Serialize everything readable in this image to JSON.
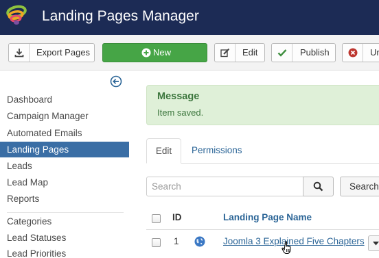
{
  "header": {
    "title": "Landing Pages Manager"
  },
  "toolbar": {
    "export_label": "Export Pages",
    "new_label": "New",
    "edit_label": "Edit",
    "publish_label": "Publish",
    "unpublish_label": "Ur"
  },
  "sidebar": {
    "items": [
      {
        "label": "Dashboard"
      },
      {
        "label": "Campaign Manager"
      },
      {
        "label": "Automated Emails"
      },
      {
        "label": "Landing Pages",
        "active": true
      },
      {
        "label": "Leads"
      },
      {
        "label": "Lead Map"
      },
      {
        "label": "Reports"
      }
    ],
    "items2": [
      {
        "label": "Categories"
      },
      {
        "label": "Lead Statuses"
      },
      {
        "label": "Lead Priorities"
      }
    ]
  },
  "alert": {
    "heading": "Message",
    "text": "Item saved."
  },
  "tabs": [
    {
      "label": "Edit"
    },
    {
      "label": "Permissions"
    }
  ],
  "search": {
    "placeholder": "Search",
    "tools_label": "Search"
  },
  "table": {
    "columns": {
      "id": "ID",
      "name": "Landing Page Name"
    },
    "rows": [
      {
        "id": "1",
        "name": "Joomla 3 Explained Five Chapters"
      }
    ]
  },
  "colors": {
    "header_bg": "#1c2b55",
    "new_button": "#46a546",
    "active_nav": "#3a6ea5",
    "link": "#2a6496",
    "alert_bg": "#dff0d8"
  }
}
